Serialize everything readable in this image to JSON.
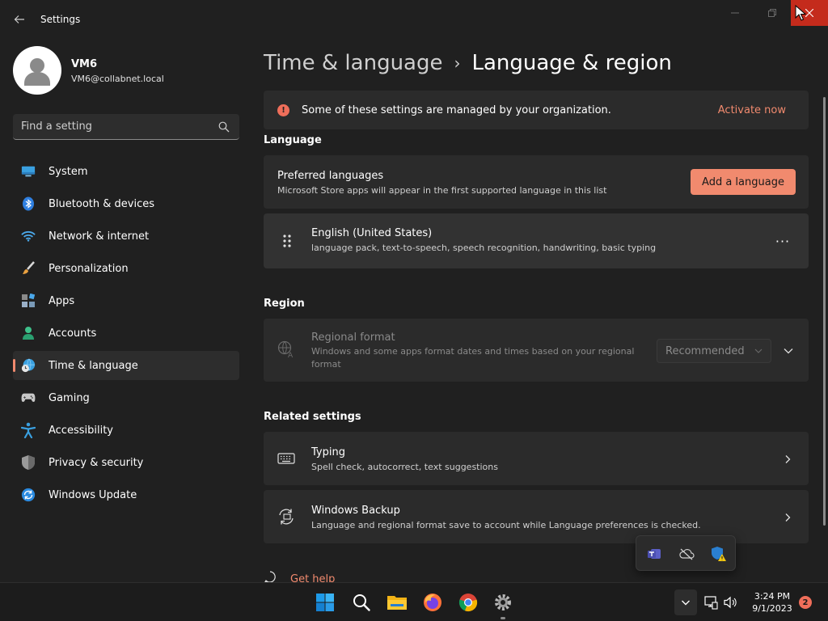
{
  "window": {
    "app_title": "Settings",
    "icons": {
      "back": "back-arrow-icon",
      "minimize": "minimize-icon",
      "maximize": "maximize-icon",
      "close": "close-icon"
    }
  },
  "profile": {
    "name": "VM6",
    "email": "VM6@collabnet.local",
    "avatar_icon": "person-icon"
  },
  "search": {
    "placeholder": "Find a setting",
    "value": ""
  },
  "sidebar": {
    "items": [
      {
        "label": "System",
        "icon": "system-monitor-icon"
      },
      {
        "label": "Bluetooth & devices",
        "icon": "bluetooth-icon"
      },
      {
        "label": "Network & internet",
        "icon": "wifi-icon"
      },
      {
        "label": "Personalization",
        "icon": "paintbrush-icon"
      },
      {
        "label": "Apps",
        "icon": "apps-icon"
      },
      {
        "label": "Accounts",
        "icon": "accounts-icon"
      },
      {
        "label": "Time & language",
        "icon": "globe-clock-icon",
        "selected": true
      },
      {
        "label": "Gaming",
        "icon": "gamepad-icon"
      },
      {
        "label": "Accessibility",
        "icon": "accessibility-icon"
      },
      {
        "label": "Privacy & security",
        "icon": "shield-icon"
      },
      {
        "label": "Windows Update",
        "icon": "windows-update-icon"
      }
    ]
  },
  "breadcrumb": {
    "parent": "Time & language",
    "separator": "›",
    "current": "Language & region"
  },
  "banner": {
    "text": "Some of these settings are managed by your organization.",
    "link": "Activate now",
    "icon_glyph": "!"
  },
  "language": {
    "section_title": "Language",
    "preferred": {
      "title": "Preferred languages",
      "subtitle": "Microsoft Store apps will appear in the first supported language in this list",
      "button": "Add a language"
    },
    "entries": [
      {
        "title": "English (United States)",
        "subtitle": "language pack, text-to-speech, speech recognition, handwriting, basic typing",
        "more_glyph": "···"
      }
    ]
  },
  "region": {
    "section_title": "Region",
    "regional_format": {
      "title": "Regional format",
      "subtitle_line1": "Windows and some apps format dates and times based on your regional",
      "subtitle_line2": "format",
      "dropdown_value": "Recommended"
    }
  },
  "related": {
    "section_title": "Related settings",
    "items": [
      {
        "title": "Typing",
        "subtitle": "Spell check, autocorrect, text suggestions",
        "icon": "keyboard-icon"
      },
      {
        "title": "Windows Backup",
        "subtitle": "Language and regional format save to account while Language preferences is checked.",
        "icon": "backup-sync-icon"
      }
    ]
  },
  "help": {
    "label": "Get help"
  },
  "tray_flyout": {
    "icons": [
      "teams-icon",
      "onedrive-offline-icon",
      "security-warning-icon"
    ]
  },
  "taskbar": {
    "apps": [
      "windows-start-icon",
      "search-icon",
      "file-explorer-icon",
      "firefox-icon",
      "chrome-icon",
      "settings-gear-icon"
    ],
    "clock_time": "3:24 PM",
    "clock_date": "9/1/2023",
    "notification_count": "2",
    "tray_overflow_glyph": "⌃"
  },
  "colors": {
    "accent": "#f18a6e",
    "background": "#202020",
    "card": "#2b2b2b",
    "close_button": "#c42b1c",
    "banner_icon": "#ef6e5a"
  }
}
